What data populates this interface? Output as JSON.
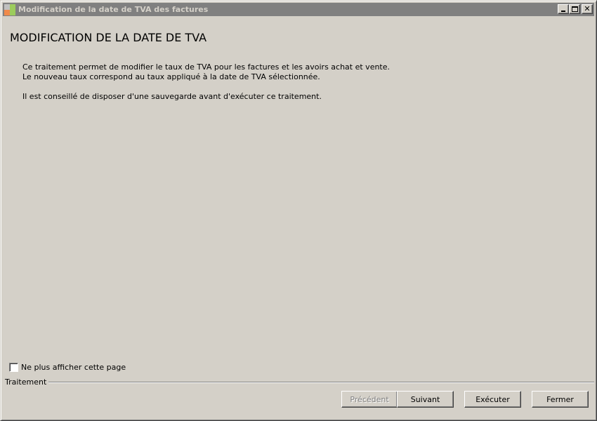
{
  "window": {
    "title": "Modification de la date de TVA des factures",
    "close_glyph": "✕"
  },
  "heading": "MODIFICATION DE LA DATE DE TVA",
  "description": {
    "line1": "Ce traitement permet de modifier le taux de TVA pour les factures et les avoirs achat et vente.",
    "line2": "Le nouveau taux correspond au taux appliqué à la date de TVA sélectionnée.",
    "line3": "Il est conseillé de disposer d'une sauvegarde avant d'exécuter ce traitement."
  },
  "checkbox": {
    "label": "Ne plus afficher cette page",
    "checked": false
  },
  "group": {
    "label": "Traitement"
  },
  "buttons": {
    "previous": "Précédent",
    "next": "Suivant",
    "execute": "Exécuter",
    "close": "Fermer"
  },
  "colors": {
    "window_bg": "#d4d0c8",
    "titlebar_bg": "#808080",
    "titlebar_text": "#d4d0c8"
  }
}
